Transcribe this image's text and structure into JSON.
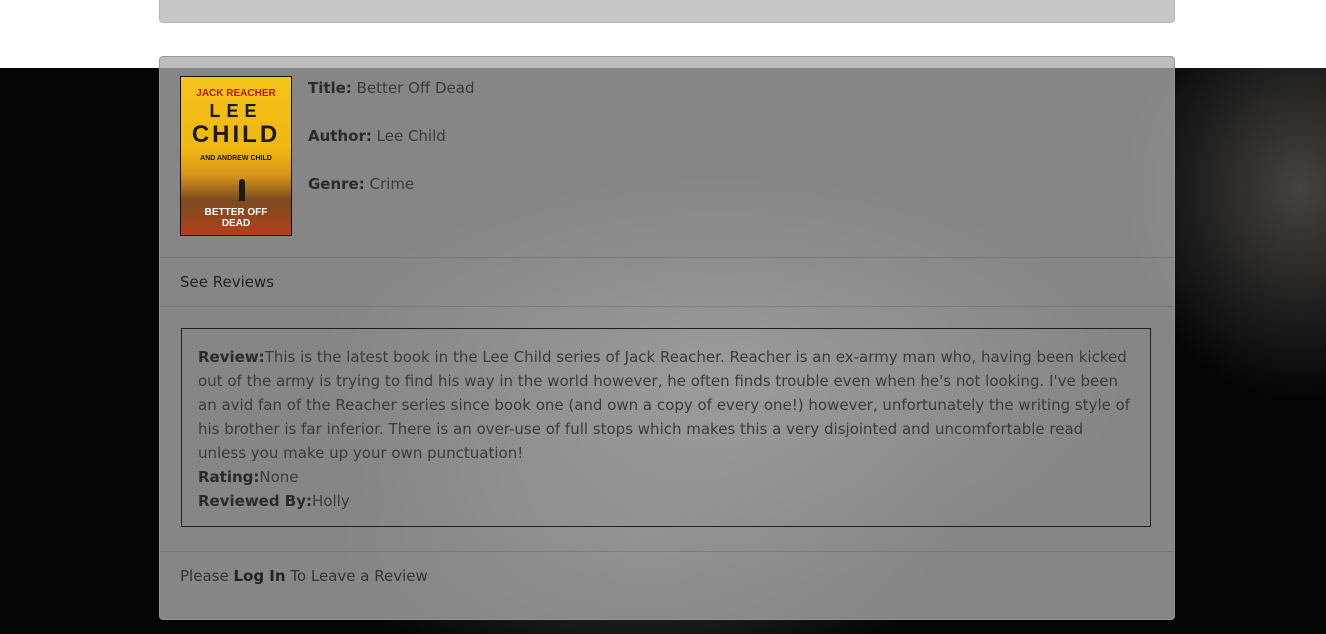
{
  "book": {
    "cover": {
      "series_text": "JACK REACHER",
      "author_first": "LEE",
      "author_last": "CHILD",
      "co_author": "AND ANDREW CHILD",
      "title_line1": "BETTER OFF",
      "title_line2": "DEAD"
    },
    "title_label": "Title:",
    "title_value": "Better Off Dead",
    "author_label": "Author:",
    "author_value": "Lee Child",
    "genre_label": "Genre:",
    "genre_value": "Crime"
  },
  "reviews": {
    "toggle_label": "See Reviews",
    "items": [
      {
        "review_label": "Review:",
        "review_text": "This is the latest book in the Lee Child series of Jack Reacher. Reacher is an ex-army man who, having been kicked out of the army is trying to find his way in the world however, he often finds trouble even when he's not looking. I've been an avid fan of the Reacher series since book one (and own a copy of every one!) however, unfortunately the writing style of his brother is far inferior. There is an over-use of full stops which makes this a very disjointed and uncomfortable read unless you make up your own punctuation!",
        "rating_label": "Rating:",
        "rating_value": "None",
        "reviewer_label": "Reviewed By:",
        "reviewer_value": "Holly"
      }
    ]
  },
  "login_prompt": {
    "prefix": "Please ",
    "link_label": "Log In",
    "suffix": " To Leave a Review"
  },
  "colors": {
    "card_bg": "#aaaaaa",
    "page_bg": "#050505",
    "top_bar": "#c7c7c7",
    "cover_yellow": "#f4c319",
    "cover_red_text": "#b21f1f"
  }
}
